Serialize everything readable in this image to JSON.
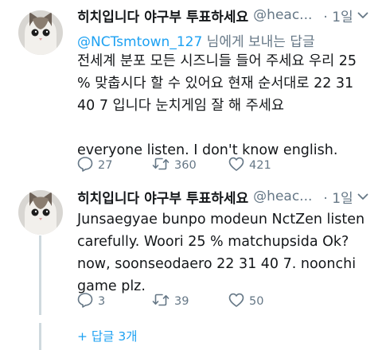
{
  "tweets": [
    {
      "display_name": "히치입니다 야구부 투표하세요",
      "handle": "@heac...",
      "time": "· 1일",
      "reply_to": {
        "mention": "@NCTsmtown_127",
        "suffix": " 님에게 보내는 답글"
      },
      "body": "전세계 분포 모든 시즈니들 들어 주세요 우리 25\n% 맞춥시다 할 수 있어요 현재 순서대로 22 31\n40 7 입니다 눈치게임 잘 해 주세요\n\neveryone listen. I don't know english.",
      "replies": "27",
      "retweets": "360",
      "likes": "421"
    },
    {
      "display_name": "히치입니다 야구부 투표하세요",
      "handle": "@heac...",
      "time": "· 1일",
      "body": "Junsaegyae bunpo modeun NctZen listen\ncarefully. Woori 25 % matchupsida Ok?\nnow, soonseodaero 22 31 40 7. noonchi\ngame plz.",
      "replies": "3",
      "retweets": "39",
      "likes": "50"
    }
  ],
  "show_replies_label": "+ 답글 3개",
  "colors": {
    "accent": "#1da1f2",
    "muted": "#657786",
    "text": "#14171a",
    "thread_line": "#cfd9de"
  },
  "icons": [
    "avatar-cat",
    "chevron-down-icon",
    "reply-icon",
    "retweet-icon",
    "like-icon"
  ]
}
